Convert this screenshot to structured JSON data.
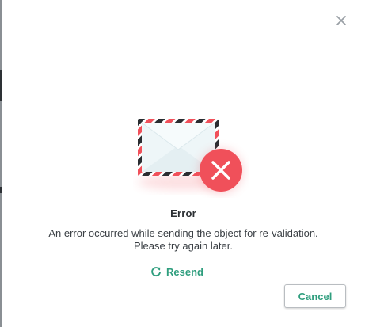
{
  "dialog": {
    "close_icon": "close-icon",
    "illustration": {
      "envelope_icon": "envelope-icon",
      "error_badge_icon": "error-x-icon"
    },
    "title": "Error",
    "message_lines": [
      "An error occurred while sending the object for re-validation.",
      "Please try again later."
    ],
    "resend": {
      "icon": "refresh-icon",
      "label": "Resend"
    },
    "cancel_label": "Cancel"
  },
  "colors": {
    "accent": "#2f9e7e",
    "error": "#f0505a",
    "title_text": "#2b2f33",
    "body_text": "#3a3f44",
    "close_icon": "#9aa0a6"
  }
}
